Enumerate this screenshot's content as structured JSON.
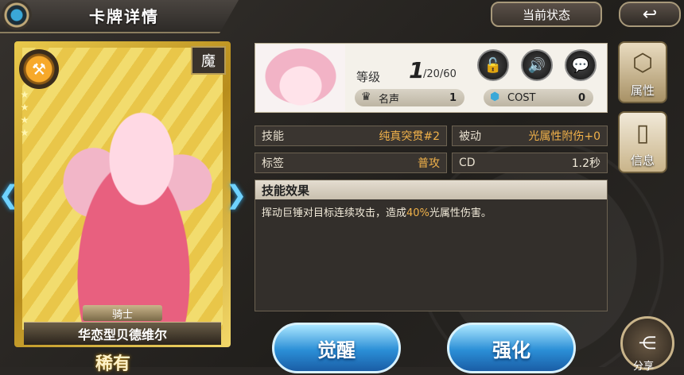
{
  "header": {
    "title": "卡牌详情",
    "state_button": "当前状态",
    "back_glyph": "↩"
  },
  "card": {
    "attribute": "魔",
    "class_glyph": "⚒",
    "stars": [
      "★",
      "★",
      "★",
      "★"
    ],
    "role": "骑士",
    "name": "华恋型贝德维尔",
    "rarity": "稀有",
    "prev_arrow": "❮",
    "next_arrow": "❯"
  },
  "profile": {
    "level_label": "等级",
    "level_current": "1",
    "level_max": "/20/60",
    "lock_glyph": "🔓",
    "sound_glyph": "🔊",
    "chat_glyph": "💬",
    "fame_label": "名声",
    "fame_value": "1",
    "cost_label": "COST",
    "cost_value": "0"
  },
  "stats": {
    "skill_label": "技能",
    "skill_value": "纯真突贯#2",
    "passive_label": "被动",
    "passive_value": "光属性附伤+0",
    "tag_label": "标签",
    "tag_value": "普攻",
    "cd_label": "CD",
    "cd_value": "1.2秒"
  },
  "effect": {
    "title": "技能效果",
    "text_before": "挥动巨锤对目标连续攻击，造成",
    "highlight": "40%",
    "text_after": "光属性伤害。"
  },
  "side": {
    "attr_label": "属性",
    "info_label": "信息"
  },
  "actions": {
    "awaken": "觉醒",
    "enhance": "强化",
    "share": "分享"
  },
  "colors": {
    "accent_gold": "#f0b14a",
    "button_blue": "#2b8ed6"
  }
}
